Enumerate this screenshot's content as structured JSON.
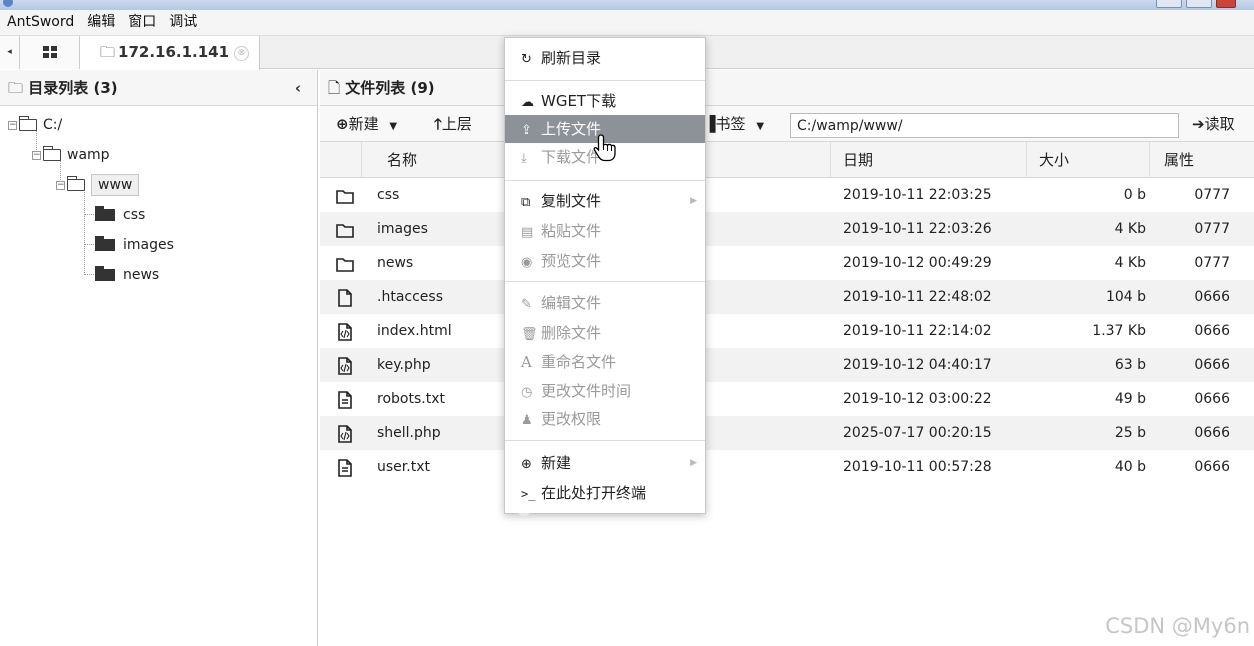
{
  "menubar": {
    "items": [
      "AntSword",
      "编辑",
      "窗口",
      "调试"
    ]
  },
  "tabs": {
    "scroll_icon": "◂",
    "grid_icon": "▪▪",
    "host_label": "172.16.1.141",
    "close_icon": "⊗"
  },
  "left_panel": {
    "title": "目录列表 (3)",
    "collapse_icon": "‹",
    "tree": {
      "root": "C:/",
      "wamp": "wamp",
      "www": "www",
      "children": [
        "css",
        "images",
        "news"
      ]
    }
  },
  "right_panel": {
    "title": "文件列表 (9)",
    "toolbar": {
      "new_label": "新建",
      "up_label": "上层",
      "bookmark_label": "书签",
      "path_value": "C:/wamp/www/",
      "read_label": "读取"
    },
    "columns": {
      "name": "名称",
      "date": "日期",
      "size": "大小",
      "perm": "属性"
    },
    "files": [
      {
        "type": "folder",
        "name": "css",
        "date": "2019-10-11 22:03:25",
        "size": "0 b",
        "perm": "0777"
      },
      {
        "type": "folder",
        "name": "images",
        "date": "2019-10-11 22:03:26",
        "size": "4 Kb",
        "perm": "0777"
      },
      {
        "type": "folder",
        "name": "news",
        "date": "2019-10-12 00:49:29",
        "size": "4 Kb",
        "perm": "0777"
      },
      {
        "type": "file",
        "name": ".htaccess",
        "date": "2019-10-11 22:48:02",
        "size": "104 b",
        "perm": "0666"
      },
      {
        "type": "code",
        "name": "index.html",
        "date": "2019-10-11 22:14:02",
        "size": "1.37 Kb",
        "perm": "0666"
      },
      {
        "type": "code",
        "name": "key.php",
        "date": "2019-10-12 04:40:17",
        "size": "63 b",
        "perm": "0666"
      },
      {
        "type": "text",
        "name": "robots.txt",
        "date": "2019-10-12 03:00:22",
        "size": "49 b",
        "perm": "0666"
      },
      {
        "type": "code",
        "name": "shell.php",
        "date": "2025-07-17 00:20:15",
        "size": "25 b",
        "perm": "0666"
      },
      {
        "type": "text",
        "name": "user.txt",
        "date": "2019-10-11 00:57:28",
        "size": "40 b",
        "perm": "0666"
      }
    ]
  },
  "context_menu": {
    "refresh": "刷新目录",
    "wget": "WGET下载",
    "upload": "上传文件",
    "download": "下载文件",
    "copy": "复制文件",
    "paste": "粘贴文件",
    "preview": "预览文件",
    "edit": "编辑文件",
    "delete": "删除文件",
    "rename": "重命名文件",
    "change_time": "更改文件时间",
    "change_perm": "更改权限",
    "new": "新建",
    "terminal": "在此处打开终端",
    "terminal_icon": ">_",
    "rename_icon": "A"
  },
  "watermark": "CSDN @My6n",
  "colors": {
    "menu_active_bg": "#8d9298",
    "row_alt_bg": "#f2f2f2",
    "disabled_text": "#9a9a9a"
  }
}
